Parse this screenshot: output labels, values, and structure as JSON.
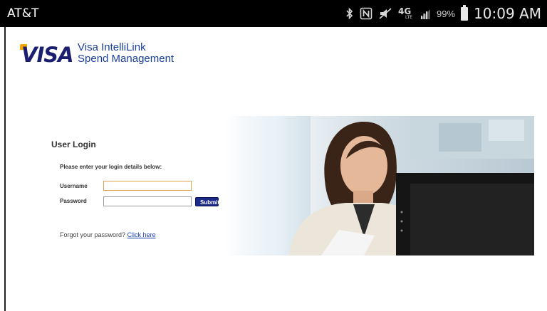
{
  "status_bar": {
    "carrier": "AT&T",
    "battery_percent": "99%",
    "time": "10:09 AM",
    "icons": [
      "bluetooth-icon",
      "nfc-icon",
      "mute-icon",
      "4g-lte-icon",
      "signal-icon",
      "battery-icon"
    ],
    "network_label": "4G"
  },
  "header": {
    "logo_text": "VISA",
    "brand_line1": "Visa IntelliLink",
    "brand_line2": "Spend Management"
  },
  "login": {
    "title": "User Login",
    "instructions": "Please enter your login details below:",
    "username_label": "Username",
    "password_label": "Password",
    "username_value": "",
    "password_value": "",
    "submit_label": "Submit",
    "forgot_text": "Forgot your password?",
    "forgot_link": "Click here"
  },
  "colors": {
    "visa_blue": "#1a1f71",
    "visa_gold": "#f7a600",
    "link_blue": "#1a3fb0",
    "submit_bg": "#1a2a8a"
  }
}
